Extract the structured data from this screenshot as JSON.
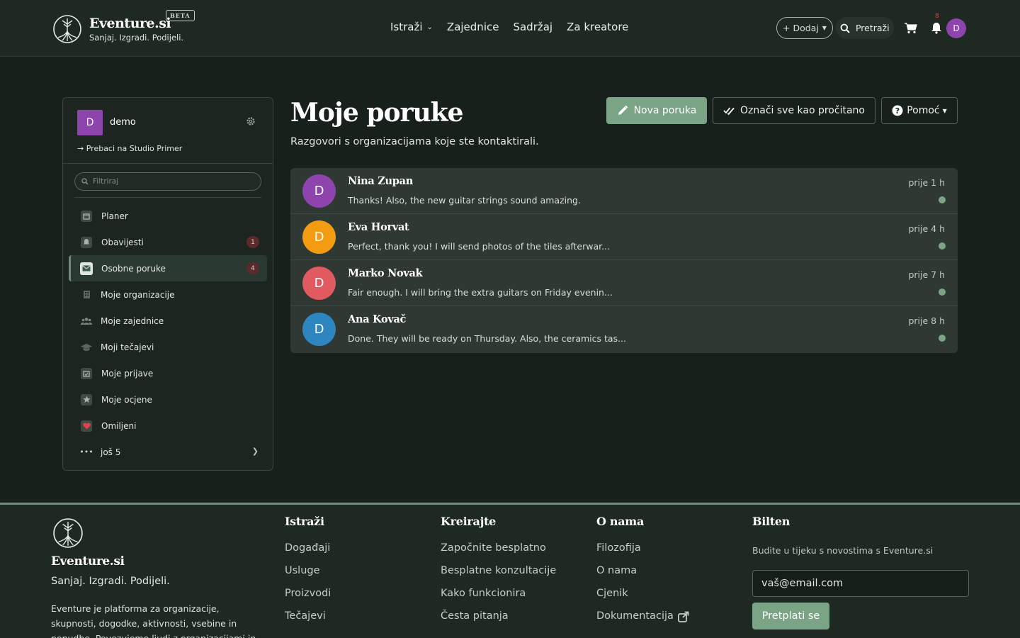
{
  "header": {
    "brand": "Eventure.si",
    "tagline": "Sanjaj. Izgradi. Podijeli.",
    "beta": "BETA",
    "nav": [
      {
        "label": "Istraži"
      },
      {
        "label": "Zajednice"
      },
      {
        "label": "Sadržaj"
      },
      {
        "label": "Za kreatore"
      }
    ],
    "add_label": "+ Dodaj",
    "search_label": "Pretraži",
    "notif_count": "8",
    "avatar_letter": "D"
  },
  "sidebar": {
    "user": {
      "letter": "D",
      "name": "demo"
    },
    "switch_label": "Prebaci na Studio Primer",
    "filter_placeholder": "Filtriraj",
    "items": [
      {
        "label": "Planer",
        "icon": "calendar-icon"
      },
      {
        "label": "Obavijesti",
        "icon": "bell-icon",
        "badge": "1"
      },
      {
        "label": "Osobne poruke",
        "icon": "envelope-icon",
        "badge": "4",
        "active": true
      },
      {
        "label": "Moje organizacije",
        "icon": "building-icon"
      },
      {
        "label": "Moje zajednice",
        "icon": "users-icon"
      },
      {
        "label": "Moji tečajevi",
        "icon": "graduation-cap-icon"
      },
      {
        "label": "Moje prijave",
        "icon": "calendar-check-icon"
      },
      {
        "label": "Moje ocjene",
        "icon": "star-icon"
      },
      {
        "label": "Omiljeni",
        "icon": "heart-icon"
      },
      {
        "label": "još 5",
        "icon": "ellipsis-icon"
      }
    ]
  },
  "main": {
    "title": "Moje poruke",
    "subtitle": "Razgovori s organizacijama koje ste kontaktirali.",
    "new_label": "Nova poruka",
    "mark_read_label": "Označi sve kao pročitano",
    "help_label": "Pomoć",
    "messages": [
      {
        "letter": "D",
        "color": "#8e44ad",
        "name": "Nina Zupan",
        "text": "Thanks! Also, the new guitar strings sound amazing.",
        "time": "prije 1 h"
      },
      {
        "letter": "D",
        "color": "#f39c12",
        "name": "Eva Horvat",
        "text": "Perfect, thank you! I will send photos of the tiles afterwar...",
        "time": "prije 4 h"
      },
      {
        "letter": "D",
        "color": "#e05a5f",
        "name": "Marko Novak",
        "text": "Fair enough. I will bring the extra guitars on Friday evenin...",
        "time": "prije 7 h"
      },
      {
        "letter": "D",
        "color": "#2e86c1",
        "name": "Ana Kovač",
        "text": "Done. They will be ready on Thursday. Also, the ceramics tas...",
        "time": "prije 8 h"
      }
    ]
  },
  "footer": {
    "brand": "Eventure.si",
    "tagline": "Sanjaj. Izgradi. Podijeli.",
    "description": "Eventure je platforma za organizacije, skupnosti, dogodke, aktivnosti, vsebine in ponudbe. Povezujemo ljudi z organizacijami in",
    "columns": [
      {
        "title": "Istraži",
        "links": [
          "Događaji",
          "Usluge",
          "Proizvodi",
          "Tečajevi"
        ]
      },
      {
        "title": "Kreirajte",
        "links": [
          "Započnite besplatno",
          "Besplatne konzultacije",
          "Kako funkcionira",
          "Česta pitanja"
        ]
      },
      {
        "title": "O nama",
        "links": [
          "Filozofija",
          "O nama",
          "Cjenik",
          "Dokumentacija"
        ]
      }
    ],
    "newsletter": {
      "title": "Bilten",
      "text": "Budite u tijeku s novostima s Eventure.si",
      "email_placeholder": "vaš@email.com",
      "subscribe_label": "Pretplati se"
    }
  },
  "colors": {
    "accent": "#7ba386",
    "background": "#18201b",
    "header": "#1e2922"
  }
}
